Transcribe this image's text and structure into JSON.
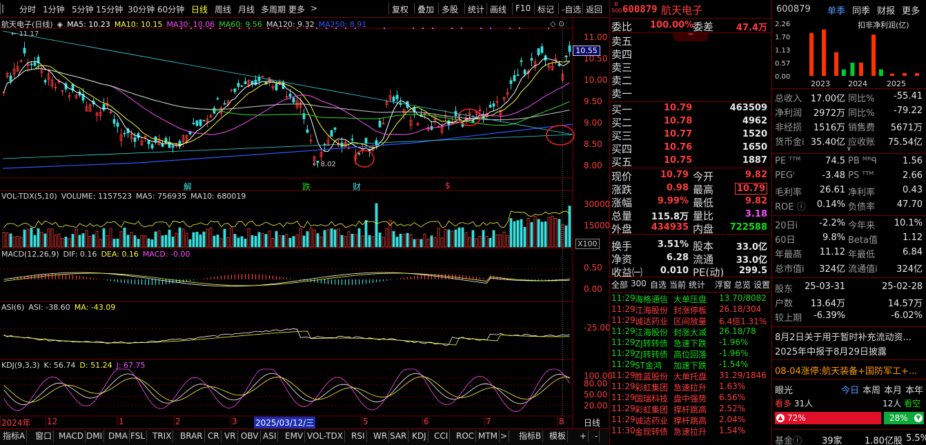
{
  "toolbar": {
    "periods": [
      "分时",
      "1分钟",
      "5分钟",
      "15分钟",
      "30分钟",
      "60分钟",
      "日线",
      "周线",
      "月线",
      "多周期",
      "更多"
    ],
    "active_period": "日线",
    "actions": [
      "复权",
      "叠加",
      "多股",
      "统计",
      "画线",
      "F10",
      "标记",
      "-自选",
      "返回"
    ]
  },
  "kline": {
    "stock_name": "航天电子(日线)",
    "ma_legend": [
      {
        "label": "MA5: 10.23",
        "color": "#ffffff"
      },
      {
        "label": "MA10: 10.15",
        "color": "#ffff33"
      },
      {
        "label": "MA30: 10.06",
        "color": "#ff4cff"
      },
      {
        "label": "MA60: 9.56",
        "color": "#33dd33"
      },
      {
        "label": "MA120: 9.32",
        "color": "#dddddd"
      },
      {
        "label": "MA250: 8.91",
        "color": "#3355ff"
      }
    ],
    "price_axis": [
      "11.00",
      "10.50",
      "10.00",
      "9.50",
      "9.00",
      "8.50",
      "8.00"
    ],
    "current_price_tag": "10.55",
    "max_label": "11.17",
    "min_label": "8.02",
    "event_markers": [
      {
        "text": "解",
        "color": "#38e0e0"
      },
      {
        "text": "跌",
        "color": "#16d916"
      },
      {
        "text": "财",
        "color": "#38e0e0"
      },
      {
        "text": "$",
        "color": "#ff3c3c"
      }
    ]
  },
  "volume": {
    "legend": [
      "VOL-TDX(5,10)",
      "VOLUME: 1157523",
      "MA5: 756935",
      "MA10: 680019"
    ],
    "axis": [
      "30000",
      "15000"
    ],
    "unit": "X100"
  },
  "macd": {
    "legend": [
      "MACD(12,26,9)",
      "DIF: 0.16",
      "DEA: 0.16",
      "MACD: -0.00"
    ],
    "axis": [
      "0.50",
      "0.00"
    ]
  },
  "asi": {
    "legend": [
      "ASI(6)",
      "ASI: -38.60",
      "MA: -43.09"
    ],
    "axis": [
      "-25.00"
    ]
  },
  "kdj": {
    "legend": [
      "KDJ(9,3,3)",
      "K: 56.74",
      "D: 51.24",
      "J: 67.75"
    ],
    "axis": [
      "100.00",
      "80.00",
      "50.00",
      "20.00"
    ]
  },
  "date_axis": [
    "2024年",
    "12",
    "1",
    "2",
    "3",
    "2025/03/12/三",
    "5",
    "6",
    "7",
    "8"
  ],
  "date_axis_right": "日线",
  "bottom_tabs": [
    "指标A",
    "窗口",
    "MACD",
    "DMI",
    "DMA",
    "FSL",
    "TRIX",
    "BRAR",
    "CR",
    "VR",
    "OBV",
    "ASI",
    "EMV",
    "VOL-TDX",
    "RSI",
    "WR",
    "SAR",
    "KDJ",
    "CCI",
    "ROC",
    "MTM",
    ">"
  ],
  "bottom_right": [
    "指标B",
    "模板",
    "+",
    "-"
  ],
  "quote": {
    "code": "600879",
    "name": "航天电子",
    "badge": "R 500",
    "weibi_label": "委比",
    "weibi": "100.00%",
    "weicha_label": "委差",
    "weicha": "47.4万",
    "asks": [
      {
        "label": "卖五"
      },
      {
        "label": "卖四"
      },
      {
        "label": "卖三"
      },
      {
        "label": "卖二"
      },
      {
        "label": "卖一"
      }
    ],
    "bids": [
      {
        "label": "买一",
        "price": "10.79",
        "vol": "463509"
      },
      {
        "label": "买二",
        "price": "10.78",
        "vol": "4962"
      },
      {
        "label": "买三",
        "price": "10.77",
        "vol": "1520"
      },
      {
        "label": "买四",
        "price": "10.76",
        "vol": "1650"
      },
      {
        "label": "买五",
        "price": "10.75",
        "vol": "1887"
      }
    ],
    "stats": [
      {
        "l1": "现价",
        "v1": "10.79",
        "c1": "red",
        "l2": "今开",
        "v2": "9.82",
        "c2": "red"
      },
      {
        "l1": "涨跌",
        "v1": "0.98",
        "c1": "red",
        "l2": "最高",
        "v2": "10.79",
        "c2": "red"
      },
      {
        "l1": "涨幅",
        "v1": "9.99%",
        "c1": "red",
        "l2": "最低",
        "v2": "9.82",
        "c2": "red"
      },
      {
        "l1": "总量",
        "v1": "115.8万",
        "c1": "white",
        "l2": "量比",
        "v2": "3.18",
        "c2": "mag"
      },
      {
        "l1": "外盘",
        "v1": "434935",
        "c1": "red",
        "l2": "内盘",
        "v2": "722588",
        "c2": "green"
      },
      {
        "l1": "换手",
        "v1": "3.51%",
        "c1": "white",
        "l2": "股本",
        "v2": "33.0亿",
        "c2": "white"
      },
      {
        "l1": "净资",
        "v1": "6.28",
        "c1": "white",
        "l2": "流通",
        "v2": "33.0亿",
        "c2": "white"
      },
      {
        "l1": "收益㈠",
        "v1": "0.010",
        "c1": "white",
        "l2": "PE(动)",
        "v2": "299.5",
        "c2": "white"
      }
    ],
    "tabs": [
      "全部",
      "300",
      "自选",
      "当前",
      "统计",
      "浮窗",
      "总览",
      "设置"
    ],
    "ticker": [
      {
        "t": "11:29",
        "n": "海格通信",
        "e": "大单压盘",
        "v": "13.70/8082",
        "c": "green"
      },
      {
        "t": "11:29",
        "n": "江海股份",
        "e": "封涨停板",
        "v": "26.18/304",
        "c": "red"
      },
      {
        "t": "11:29",
        "n": "诚达药业",
        "e": "区间放量",
        "v": "6.4倍1.31%",
        "c": "red"
      },
      {
        "t": "11:29",
        "n": "江海股份",
        "e": "封涨大减",
        "v": "26.18/78",
        "c": "green"
      },
      {
        "t": "11:29",
        "n": "ZJ转转债",
        "e": "急速下跌",
        "v": "-1.96%",
        "c": "green"
      },
      {
        "t": "11:29",
        "n": "ZJ转转债",
        "e": "高位回落",
        "v": "-1.96%",
        "c": "green"
      },
      {
        "t": "11:29",
        "n": "ST金鸿",
        "e": "加速下跌",
        "v": "-1.54%",
        "c": "green"
      },
      {
        "t": "11:29",
        "n": "胜蓝股份",
        "e": "大单托盘",
        "v": "31.29/1846",
        "c": "red"
      },
      {
        "t": "11:29",
        "n": "彩虹集团",
        "e": "急速拉升",
        "v": "1.63%",
        "c": "red"
      },
      {
        "t": "11:29",
        "n": "国瑞科技",
        "e": "盘中强势",
        "v": "6.56%",
        "c": "red"
      },
      {
        "t": "11:29",
        "n": "彩虹集团",
        "e": "撑杆跳高",
        "v": "2.52%",
        "c": "red"
      },
      {
        "t": "11:29",
        "n": "诚达药业",
        "e": "撑杆跳高",
        "v": "2.04%",
        "c": "red"
      },
      {
        "t": "11:30",
        "n": "金现转债",
        "e": "急速拉升",
        "v": "1.54%",
        "c": "red"
      }
    ]
  },
  "fin": {
    "code": "600879",
    "tabs": [
      "单季",
      "同季",
      "财报",
      "更多"
    ],
    "chart_title": "扣非净利润(亿)",
    "chart_data": {
      "type": "bar",
      "ylim": [
        0,
        2.26
      ],
      "y_ticks": [
        "2.26",
        "1.70",
        "1.13",
        "0.57",
        "0.00"
      ],
      "x_labels": [
        "2023",
        "2024",
        "2025"
      ],
      "series": [
        {
          "color": "#ff3300",
          "values": [
            1.85,
            2.0,
            1.02,
            0.57,
            1.78,
            0.1,
            0.12,
            0.12
          ]
        },
        {
          "color": "#00cc33",
          "values": [
            0.57,
            0.0,
            0.28,
            0.0,
            0.28,
            0.0,
            0.0,
            0.0
          ]
        }
      ]
    },
    "rows1": [
      {
        "l1": "总收入",
        "v1": "17.00亿",
        "l2": "同比%",
        "v2": "-55.41"
      },
      {
        "l1": "净利润",
        "v1": "2972万",
        "l2": "同比%",
        "v2": "-79.22"
      },
      {
        "l1": "非经损",
        "v1": "1516万",
        "l2": "销售费",
        "v2": "5671万"
      },
      {
        "l1": "货币金ⅰ",
        "v1": "35.40亿",
        "l2": "应收账",
        "v2": "75.54亿"
      }
    ],
    "rows2": [
      {
        "l1": "PE ᵀᵀᴹ",
        "v1": "74.5",
        "l2": "PB ᴹᴿᑫ",
        "v2": "1.56"
      },
      {
        "l1": "PEGⁱ",
        "v1": "-3.48",
        "l2": "PS ᵀᵀᴹ",
        "v2": "2.66"
      },
      {
        "l1": "毛利率",
        "v1": "26.61",
        "l2": "净利率",
        "v2": "0.43"
      },
      {
        "l1": "ROE ⓘ",
        "v1": "0.14%",
        "l2": "负债率",
        "v2": "47.70"
      }
    ],
    "rows3": [
      {
        "l1": "20日ⅰ",
        "v1": "-2.2%",
        "l2": "今年来",
        "v2": "10.1%"
      },
      {
        "l1": "60日",
        "v1": "9.8%",
        "l2": "Beta值",
        "v2": "1.12"
      },
      {
        "l1": "年最高",
        "v1": "11.12",
        "l2": "年最低",
        "v2": "6.84"
      },
      {
        "l1": "总市值ⅰ",
        "v1": "324亿",
        "l2": "流通值ⅰ",
        "v2": "324亿"
      }
    ],
    "holders": [
      {
        "l": "股东",
        "a": "25-03-31",
        "b": "25-02-28"
      },
      {
        "l": "户数",
        "a": "13.64万",
        "b": "14.57万"
      },
      {
        "l": "较上期",
        "a": "-6.39%",
        "b": "-6.02%"
      }
    ],
    "news1": "8月2日关于用于暂时补充流动资...",
    "news2": "2025年中报于8月29日披露",
    "limit_news": "08-04涨停:航天装备+国防军工+...",
    "eye_label": "眼光",
    "eye_tabs": [
      "今日",
      "本周",
      "本月",
      "本年"
    ],
    "bull_label": "看多",
    "bull_count": "31人",
    "bear_count": "12人",
    "bear_label": "看空",
    "bull_pct": "72%",
    "bear_pct": "28%",
    "fund_label": "基金ⓘ",
    "fund_count": "39家",
    "fund_amt": "1.80亿股",
    "fund_pct": "5.5%"
  }
}
